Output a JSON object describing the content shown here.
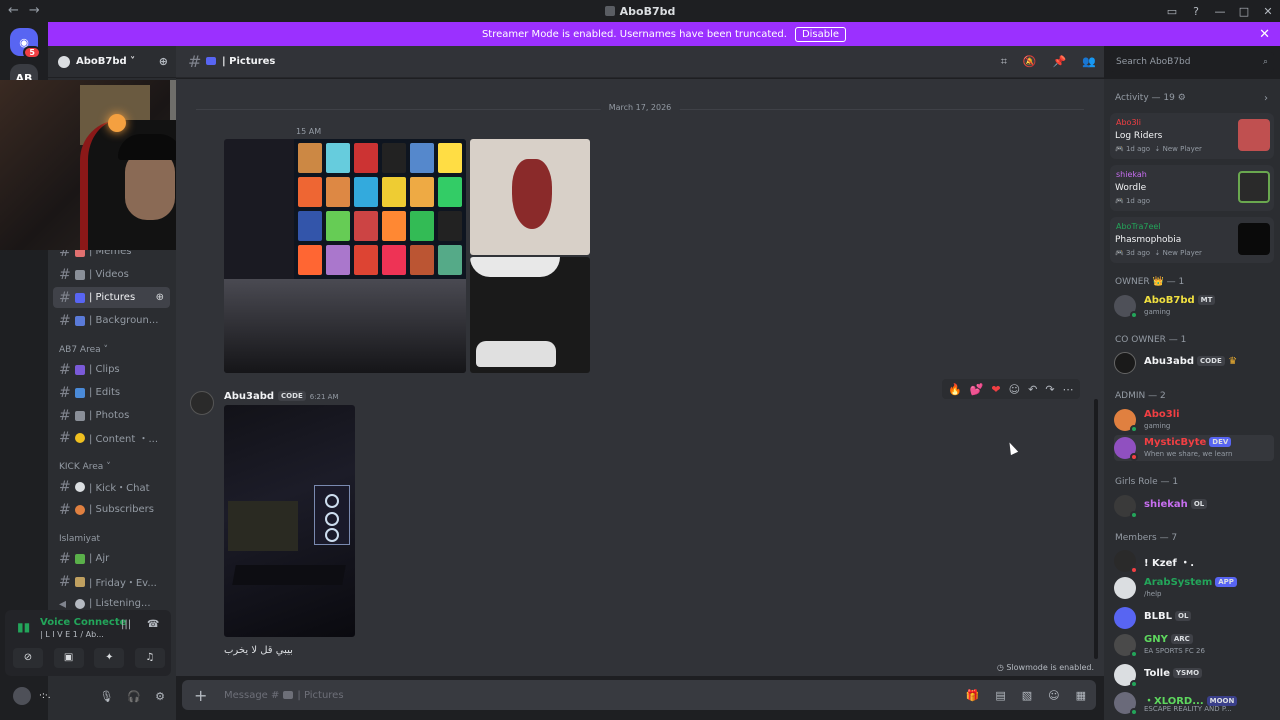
{
  "window": {
    "title": "AboB7bd"
  },
  "banner": {
    "text": "Streamer Mode is enabled. Usernames have been truncated.",
    "button": "Disable"
  },
  "guild": {
    "name": "AboB7bd"
  },
  "servers": [
    {
      "badge": "5"
    },
    {
      "label": "AB"
    }
  ],
  "sidebar": {
    "channels_top": [
      {
        "name": "| Memes"
      },
      {
        "name": "| Videos"
      },
      {
        "name": "| Pictures"
      },
      {
        "name": "| Backgroun..."
      }
    ],
    "category_ab7": "AB7 Area",
    "channels_ab7": [
      {
        "name": "| Clips"
      },
      {
        "name": "| Edits"
      },
      {
        "name": "| Photos"
      },
      {
        "name": "| Content ・..."
      }
    ],
    "category_kick": "KICK Area",
    "channels_kick": [
      {
        "name": "| Kick・Chat"
      },
      {
        "name": "| Subscribers"
      }
    ],
    "category_islam": "Islamiyat",
    "channels_islam": [
      {
        "name": "| Ajr"
      },
      {
        "name": "| Friday・Ev..."
      },
      {
        "name": "| Listening..."
      }
    ]
  },
  "voice": {
    "status": "Voice Connecte",
    "sub": "| L I V E 1 / Ab..."
  },
  "userbar": {
    "name": "·:·."
  },
  "channel_header": {
    "name": "| Pictures"
  },
  "search": {
    "placeholder": "Search AboB7bd"
  },
  "chat": {
    "date": "March 17, 2026",
    "timestamp_fragment": "15 AM",
    "message": {
      "author": "Abu3abd",
      "tag": "CODE",
      "time": "6:21 AM",
      "text": "بيبي قل لا يخرب"
    },
    "slowmode": "Slowmode is enabled."
  },
  "composer": {
    "placeholder_prefix": "Message #",
    "placeholder_channel": "| Pictures"
  },
  "activity": {
    "header": "Activity — 19",
    "cards": [
      {
        "who": "Abo3li",
        "game": "Log Riders",
        "meta": "1d ago",
        "extra": "New Player",
        "who_color": "#f23f43"
      },
      {
        "who": "shiekah",
        "game": "Wordle",
        "meta": "1d ago",
        "extra": "",
        "who_color": "#c76ef0"
      },
      {
        "who": "AboTra7eel",
        "game": "Phasmophobia",
        "meta": "3d ago",
        "extra": "New Player",
        "who_color": "#23a55a"
      }
    ]
  },
  "member_groups": {
    "owner": "OWNER 👑 — 1",
    "co_owner": "CO OWNER — 1",
    "admin": "ADMIN — 2",
    "girls": "Girls Role — 1",
    "members": "Members — 7"
  },
  "members": {
    "owner": [
      {
        "name": "AboB7bd",
        "tag": "MT",
        "status": "gaming",
        "color": "#f0e040"
      }
    ],
    "co_owner": [
      {
        "name": "Abu3abd",
        "tag": "CODE",
        "status": "",
        "color": "#f2f3f5"
      }
    ],
    "admin": [
      {
        "name": "Abo3li",
        "tag": "",
        "status": "gaming",
        "color": "#f23f43"
      },
      {
        "name": "MysticByte",
        "tag": "DEV",
        "status": "When we share, we learn",
        "color": "#f23f43"
      }
    ],
    "girls": [
      {
        "name": "shiekah",
        "tag": "OL",
        "status": "",
        "color": "#c76ef0"
      }
    ],
    "members": [
      {
        "name": "! Kzef ・.",
        "tag": "",
        "status": "",
        "color": "#f2f3f5"
      },
      {
        "name": "ArabSystem",
        "tag": "APP",
        "status": "/help",
        "color": "#23a55a"
      },
      {
        "name": "BLBL",
        "tag": "OL",
        "status": "",
        "color": "#f2f3f5"
      },
      {
        "name": "GNY",
        "tag": "ARC",
        "status": "EA SPORTS FC 26",
        "color": "#5ed85e"
      },
      {
        "name": "Tolle",
        "tag": "YSMO",
        "status": "",
        "color": "#f2f3f5"
      },
      {
        "name": "・XLORD...",
        "tag": "MOON",
        "status": "ESCAPE REALITY AND P...",
        "color": "#5ed85e"
      }
    ]
  },
  "colors": {
    "banner": "#9b30ff",
    "online": "#23a55a",
    "accent": "#5865f2"
  }
}
